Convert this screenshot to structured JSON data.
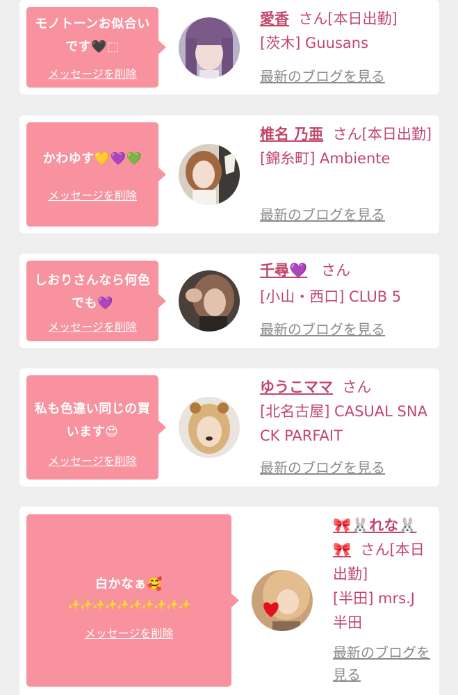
{
  "delete_label": "メッセージを削除",
  "blog_label": "最新のブログを見る",
  "san_label": "さん",
  "cards": [
    {
      "message": "モノトーンお似合いです🖤⬚",
      "name": "愛香",
      "suffix": "さん[本日出勤]",
      "shop": "[茨木] Guusans"
    },
    {
      "message": "かわゆす💛💜💚",
      "name": "椎名 乃亜",
      "suffix": "さん[本日出勤]",
      "shop": "[錦糸町] Ambiente"
    },
    {
      "message": "しおりさんなら何色でも💜",
      "name": "千尋💜",
      "suffix": "さん",
      "shop": "[小山・西口] CLUB 5"
    },
    {
      "message": "私も色違い同じの買います😍",
      "name": "ゆうこママ",
      "suffix": "さん",
      "shop": "[北名古屋] CASUAL SNACK PARFAIT"
    },
    {
      "message_line1": "白かなぁ🥰",
      "message_line2": "✨✨✨✨✨✨✨✨✨✨",
      "name": "🎀🐰れな🐰🎀",
      "suffix": "さん[本日出勤]",
      "shop": "[半田] mrs.J 半田"
    }
  ],
  "colors": {
    "bubble": "#f7929e",
    "name": "#c2476a",
    "link_gray": "#8c8c8c",
    "background": "#eeeeee"
  }
}
